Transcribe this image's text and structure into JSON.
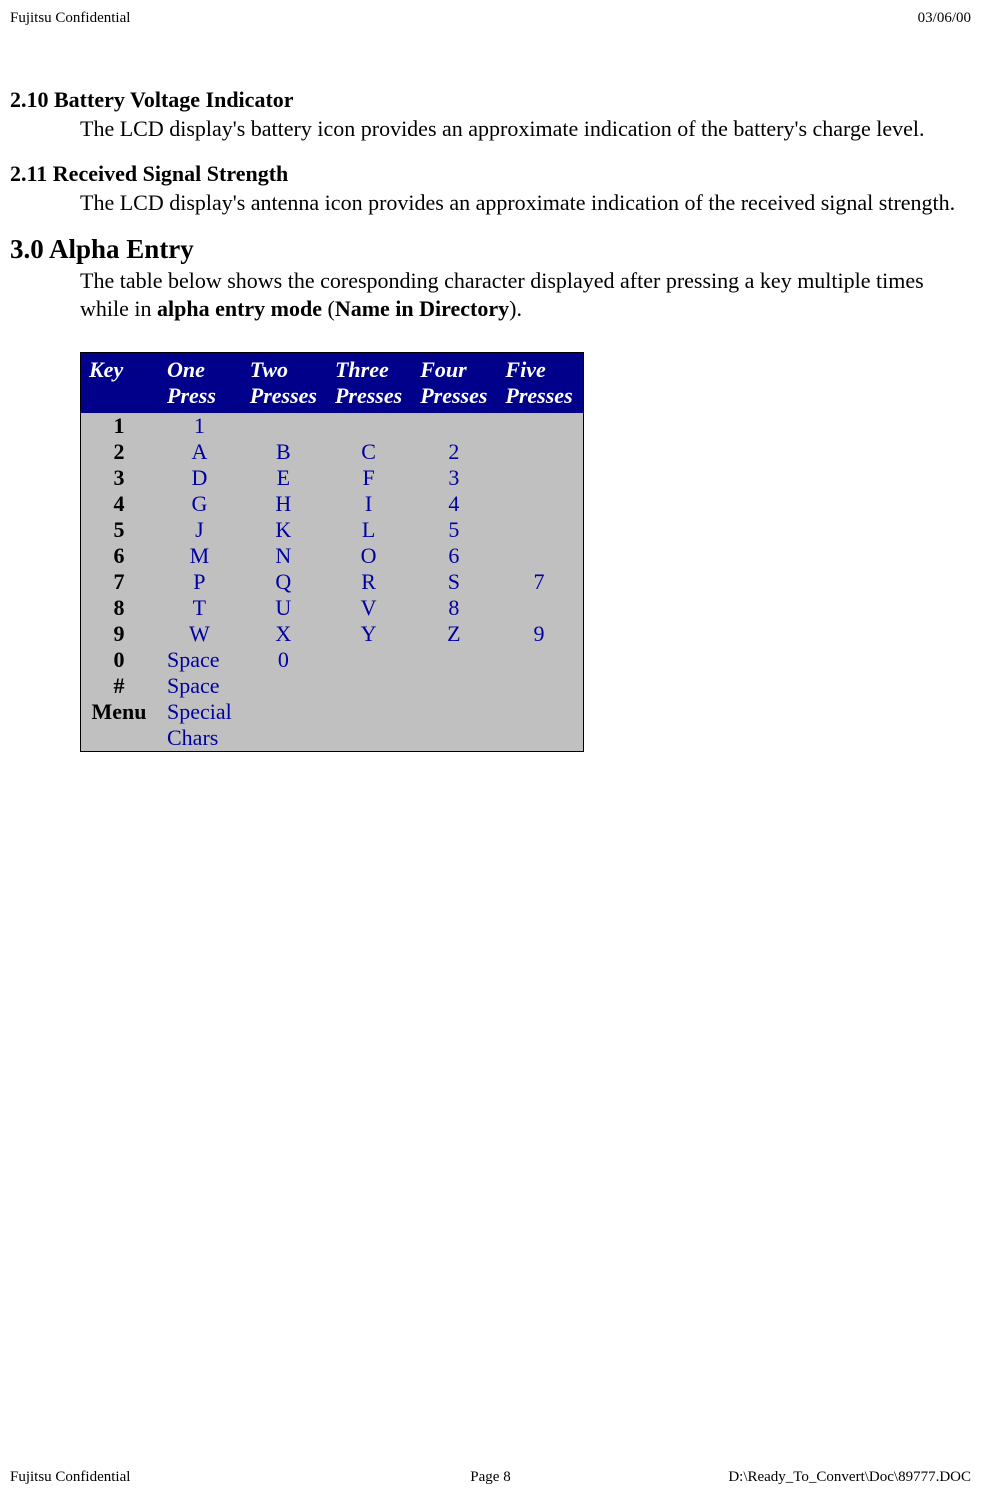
{
  "header": {
    "left": "Fujitsu Confidential",
    "right": "03/06/00"
  },
  "sections": {
    "s1": {
      "heading": "2.10 Battery Voltage Indicator",
      "body": "The LCD display's battery icon provides an approximate indication of the battery's charge level."
    },
    "s2": {
      "heading": "2.11 Received Signal Strength",
      "body": "The LCD display's antenna icon provides an approximate indication of the received signal strength."
    },
    "s3": {
      "heading": "3.0 Alpha Entry",
      "body_pre": "The table below shows the coresponding character displayed after pressing a key multiple times while in ",
      "body_bold1": "alpha entry mode",
      "body_mid": " (",
      "body_bold2": "Name in Directory",
      "body_post": ")."
    }
  },
  "table": {
    "headers": {
      "c0": "Key",
      "c1a": "One",
      "c1b": "Press",
      "c2a": "Two",
      "c2b": "Presses",
      "c3a": "Three",
      "c3b": "Presses",
      "c4a": "Four",
      "c4b": "Presses",
      "c5a": "Five",
      "c5b": "Presses"
    },
    "rows": [
      {
        "k": "1",
        "c1": "1",
        "c2": "",
        "c3": "",
        "c4": "",
        "c5": ""
      },
      {
        "k": "2",
        "c1": "A",
        "c2": "B",
        "c3": "C",
        "c4": "2",
        "c5": ""
      },
      {
        "k": "3",
        "c1": "D",
        "c2": "E",
        "c3": "F",
        "c4": "3",
        "c5": ""
      },
      {
        "k": "4",
        "c1": "G",
        "c2": "H",
        "c3": "I",
        "c4": "4",
        "c5": ""
      },
      {
        "k": "5",
        "c1": "J",
        "c2": "K",
        "c3": "L",
        "c4": "5",
        "c5": ""
      },
      {
        "k": "6",
        "c1": "M",
        "c2": "N",
        "c3": "O",
        "c4": "6",
        "c5": ""
      },
      {
        "k": "7",
        "c1": "P",
        "c2": "Q",
        "c3": "R",
        "c4": "S",
        "c5": "7"
      },
      {
        "k": "8",
        "c1": "T",
        "c2": "U",
        "c3": "V",
        "c4": "8",
        "c5": ""
      },
      {
        "k": "9",
        "c1": "W",
        "c2": "X",
        "c3": "Y",
        "c4": "Z",
        "c5": "9"
      },
      {
        "k": "0",
        "c1": "Space",
        "c2": "0",
        "c3": "",
        "c4": "",
        "c5": ""
      },
      {
        "k": "#",
        "c1": "Space",
        "c2": "",
        "c3": "",
        "c4": "",
        "c5": ""
      },
      {
        "k": "Menu",
        "c1": "Special",
        "c2": "",
        "c3": "",
        "c4": "",
        "c5": ""
      },
      {
        "k": "",
        "c1": "Chars",
        "c2": "",
        "c3": "",
        "c4": "",
        "c5": ""
      }
    ]
  },
  "footer": {
    "left": "Fujitsu Confidential",
    "center": "Page 8",
    "right": "D:\\Ready_To_Convert\\Doc\\89777.DOC"
  }
}
